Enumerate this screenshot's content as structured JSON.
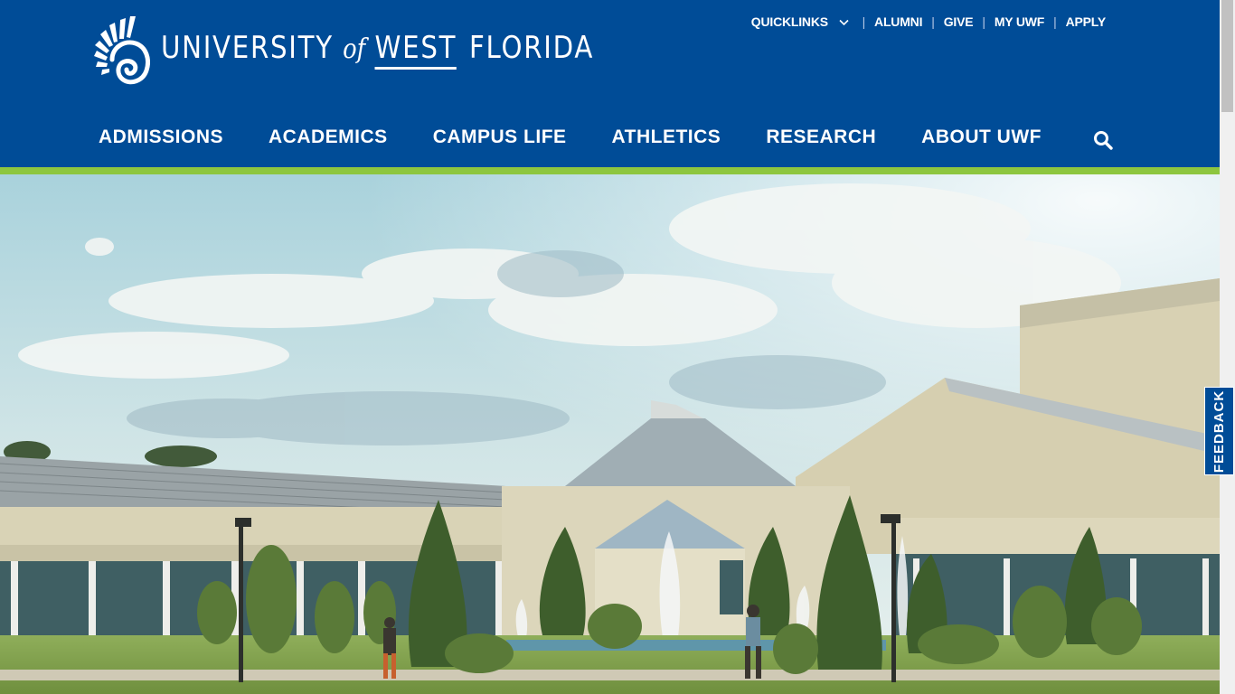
{
  "colors": {
    "header_bg": "#004c97",
    "accent_stripe": "#8dc63f"
  },
  "logo": {
    "part1": "UNIVERSITY",
    "part2": "of",
    "part3": "WEST",
    "part4": "FLORIDA"
  },
  "utility_nav": [
    {
      "label": "QUICKLINKS",
      "icon": "chevron-down-icon"
    },
    {
      "label": "ALUMNI"
    },
    {
      "label": "GIVE"
    },
    {
      "label": "MY UWF"
    },
    {
      "label": "APPLY"
    }
  ],
  "main_nav": [
    {
      "label": "ADMISSIONS"
    },
    {
      "label": "ACADEMICS"
    },
    {
      "label": "CAMPUS LIFE"
    },
    {
      "label": "ATHLETICS"
    },
    {
      "label": "RESEARCH"
    },
    {
      "label": "ABOUT UWF"
    }
  ],
  "search": {
    "icon": "search-icon"
  },
  "feedback": {
    "label": "FEEDBACK"
  }
}
